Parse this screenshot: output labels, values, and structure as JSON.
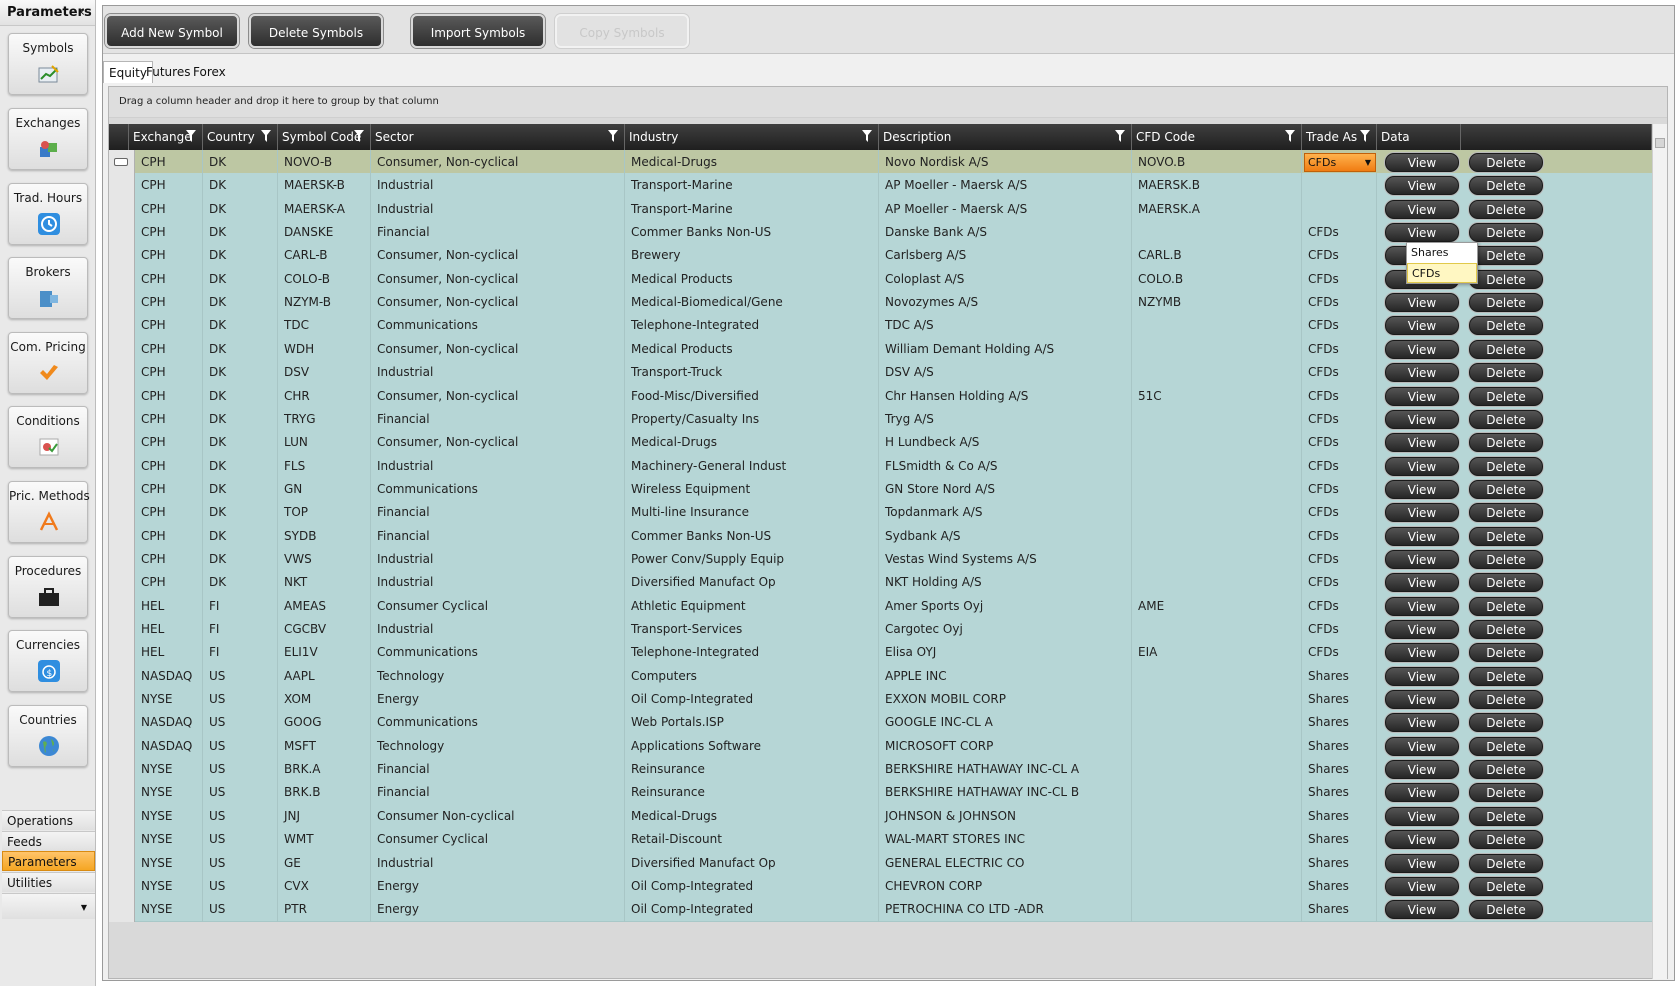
{
  "left_panel": {
    "title": "Parameters",
    "nav": [
      {
        "label": "Symbols",
        "icon": "symbols-chart-icon"
      },
      {
        "label": "Exchanges",
        "icon": "exchanges-icon"
      },
      {
        "label": "Trad. Hours",
        "icon": "clock-icon"
      },
      {
        "label": "Brokers",
        "icon": "broker-icon"
      },
      {
        "label": "Com. Pricing",
        "icon": "commission-icon"
      },
      {
        "label": "Conditions",
        "icon": "conditions-icon"
      },
      {
        "label": "Pric. Methods",
        "icon": "pricing-methods-icon"
      },
      {
        "label": "Procedures",
        "icon": "briefcase-icon"
      },
      {
        "label": "Currencies",
        "icon": "currency-icon"
      },
      {
        "label": "Countries",
        "icon": "globe-icon"
      }
    ],
    "sections": [
      "Operations",
      "Feeds",
      "Parameters",
      "Utilities"
    ],
    "active_section": "Parameters"
  },
  "toolbar": {
    "add_label": "Add New Symbol",
    "delete_label": "Delete Symbols",
    "import_label": "Import Symbols",
    "copy_label": "Copy Symbols"
  },
  "tabs": [
    "Equity",
    "Futures",
    "Forex"
  ],
  "grid": {
    "group_hint": "Drag a column header and drop it here to group by that column",
    "columns": [
      "Exchange",
      "Country",
      "Symbol Code",
      "Sector",
      "Industry",
      "Description",
      "CFD Code",
      "Trade As",
      "Data",
      ""
    ],
    "view_label": "View",
    "delete_label": "Delete",
    "trade_dropdown": {
      "selected": "CFDs",
      "options": [
        "Shares",
        "CFDs"
      ]
    },
    "rows": [
      {
        "exchange": "CPH",
        "country": "DK",
        "symbol": "NOVO-B",
        "sector": "Consumer, Non-cyclical",
        "industry": "Medical-Drugs",
        "description": "Novo Nordisk A/S",
        "cfd": "NOVO.B",
        "trade": "CFDs"
      },
      {
        "exchange": "CPH",
        "country": "DK",
        "symbol": "MAERSK-B",
        "sector": "Industrial",
        "industry": "Transport-Marine",
        "description": "AP Moeller - Maersk A/S",
        "cfd": "MAERSK.B",
        "trade": ""
      },
      {
        "exchange": "CPH",
        "country": "DK",
        "symbol": "MAERSK-A",
        "sector": "Industrial",
        "industry": "Transport-Marine",
        "description": "AP Moeller - Maersk A/S",
        "cfd": "MAERSK.A",
        "trade": ""
      },
      {
        "exchange": "CPH",
        "country": "DK",
        "symbol": "DANSKE",
        "sector": "Financial",
        "industry": "Commer Banks Non-US",
        "description": "Danske Bank A/S",
        "cfd": "",
        "trade": "CFDs"
      },
      {
        "exchange": "CPH",
        "country": "DK",
        "symbol": "CARL-B",
        "sector": "Consumer, Non-cyclical",
        "industry": "Brewery",
        "description": "Carlsberg A/S",
        "cfd": "CARL.B",
        "trade": "CFDs"
      },
      {
        "exchange": "CPH",
        "country": "DK",
        "symbol": "COLO-B",
        "sector": "Consumer, Non-cyclical",
        "industry": "Medical Products",
        "description": "Coloplast A/S",
        "cfd": "COLO.B",
        "trade": "CFDs"
      },
      {
        "exchange": "CPH",
        "country": "DK",
        "symbol": "NZYM-B",
        "sector": "Consumer, Non-cyclical",
        "industry": "Medical-Biomedical/Gene",
        "description": "Novozymes A/S",
        "cfd": "NZYMB",
        "trade": "CFDs"
      },
      {
        "exchange": "CPH",
        "country": "DK",
        "symbol": "TDC",
        "sector": "Communications",
        "industry": "Telephone-Integrated",
        "description": "TDC A/S",
        "cfd": "",
        "trade": "CFDs"
      },
      {
        "exchange": "CPH",
        "country": "DK",
        "symbol": "WDH",
        "sector": "Consumer, Non-cyclical",
        "industry": "Medical Products",
        "description": "William Demant Holding A/S",
        "cfd": "",
        "trade": "CFDs"
      },
      {
        "exchange": "CPH",
        "country": "DK",
        "symbol": "DSV",
        "sector": "Industrial",
        "industry": "Transport-Truck",
        "description": "DSV A/S",
        "cfd": "",
        "trade": "CFDs"
      },
      {
        "exchange": "CPH",
        "country": "DK",
        "symbol": "CHR",
        "sector": "Consumer, Non-cyclical",
        "industry": "Food-Misc/Diversified",
        "description": "Chr Hansen Holding A/S",
        "cfd": "51C",
        "trade": "CFDs"
      },
      {
        "exchange": "CPH",
        "country": "DK",
        "symbol": "TRYG",
        "sector": "Financial",
        "industry": "Property/Casualty Ins",
        "description": "Tryg A/S",
        "cfd": "",
        "trade": "CFDs"
      },
      {
        "exchange": "CPH",
        "country": "DK",
        "symbol": "LUN",
        "sector": "Consumer, Non-cyclical",
        "industry": "Medical-Drugs",
        "description": "H Lundbeck A/S",
        "cfd": "",
        "trade": "CFDs"
      },
      {
        "exchange": "CPH",
        "country": "DK",
        "symbol": "FLS",
        "sector": "Industrial",
        "industry": "Machinery-General Indust",
        "description": "FLSmidth & Co A/S",
        "cfd": "",
        "trade": "CFDs"
      },
      {
        "exchange": "CPH",
        "country": "DK",
        "symbol": "GN",
        "sector": "Communications",
        "industry": "Wireless Equipment",
        "description": "GN Store Nord A/S",
        "cfd": "",
        "trade": "CFDs"
      },
      {
        "exchange": "CPH",
        "country": "DK",
        "symbol": "TOP",
        "sector": "Financial",
        "industry": "Multi-line Insurance",
        "description": "Topdanmark A/S",
        "cfd": "",
        "trade": "CFDs"
      },
      {
        "exchange": "CPH",
        "country": "DK",
        "symbol": "SYDB",
        "sector": "Financial",
        "industry": "Commer Banks Non-US",
        "description": "Sydbank A/S",
        "cfd": "",
        "trade": "CFDs"
      },
      {
        "exchange": "CPH",
        "country": "DK",
        "symbol": "VWS",
        "sector": "Industrial",
        "industry": "Power Conv/Supply Equip",
        "description": "Vestas Wind Systems A/S",
        "cfd": "",
        "trade": "CFDs"
      },
      {
        "exchange": "CPH",
        "country": "DK",
        "symbol": "NKT",
        "sector": "Industrial",
        "industry": "Diversified Manufact Op",
        "description": "NKT Holding A/S",
        "cfd": "",
        "trade": "CFDs"
      },
      {
        "exchange": "HEL",
        "country": "FI",
        "symbol": "AMEAS",
        "sector": "Consumer Cyclical",
        "industry": "Athletic Equipment",
        "description": "Amer Sports Oyj",
        "cfd": "AME",
        "trade": "CFDs"
      },
      {
        "exchange": "HEL",
        "country": "FI",
        "symbol": "CGCBV",
        "sector": "Industrial",
        "industry": "Transport-Services",
        "description": "Cargotec Oyj",
        "cfd": "",
        "trade": "CFDs"
      },
      {
        "exchange": "HEL",
        "country": "FI",
        "symbol": "ELI1V",
        "sector": "Communications",
        "industry": "Telephone-Integrated",
        "description": "Elisa OYJ",
        "cfd": "EIA",
        "trade": "CFDs"
      },
      {
        "exchange": "NASDAQ",
        "country": "US",
        "symbol": "AAPL",
        "sector": "Technology",
        "industry": "Computers",
        "description": "APPLE INC",
        "cfd": "",
        "trade": "Shares"
      },
      {
        "exchange": "NYSE",
        "country": "US",
        "symbol": "XOM",
        "sector": "Energy",
        "industry": "Oil Comp-Integrated",
        "description": "EXXON MOBIL CORP",
        "cfd": "",
        "trade": "Shares"
      },
      {
        "exchange": "NASDAQ",
        "country": "US",
        "symbol": "GOOG",
        "sector": "Communications",
        "industry": "Web Portals.ISP",
        "description": "GOOGLE INC-CL A",
        "cfd": "",
        "trade": "Shares"
      },
      {
        "exchange": "NASDAQ",
        "country": "US",
        "symbol": "MSFT",
        "sector": "Technology",
        "industry": "Applications Software",
        "description": "MICROSOFT CORP",
        "cfd": "",
        "trade": "Shares"
      },
      {
        "exchange": "NYSE",
        "country": "US",
        "symbol": "BRK.A",
        "sector": "Financial",
        "industry": "Reinsurance",
        "description": "BERKSHIRE HATHAWAY INC-CL A",
        "cfd": "",
        "trade": "Shares"
      },
      {
        "exchange": "NYSE",
        "country": "US",
        "symbol": "BRK.B",
        "sector": "Financial",
        "industry": "Reinsurance",
        "description": "BERKSHIRE HATHAWAY INC-CL B",
        "cfd": "",
        "trade": "Shares"
      },
      {
        "exchange": "NYSE",
        "country": "US",
        "symbol": "JNJ",
        "sector": "Consumer Non-cyclical",
        "industry": "Medical-Drugs",
        "description": "JOHNSON & JOHNSON",
        "cfd": "",
        "trade": "Shares"
      },
      {
        "exchange": "NYSE",
        "country": "US",
        "symbol": "WMT",
        "sector": "Consumer Cyclical",
        "industry": "Retail-Discount",
        "description": "WAL-MART STORES INC",
        "cfd": "",
        "trade": "Shares"
      },
      {
        "exchange": "NYSE",
        "country": "US",
        "symbol": "GE",
        "sector": "Industrial",
        "industry": "Diversified Manufact Op",
        "description": "GENERAL ELECTRIC CO",
        "cfd": "",
        "trade": "Shares"
      },
      {
        "exchange": "NYSE",
        "country": "US",
        "symbol": "CVX",
        "sector": "Energy",
        "industry": "Oil Comp-Integrated",
        "description": "CHEVRON CORP",
        "cfd": "",
        "trade": "Shares"
      },
      {
        "exchange": "NYSE",
        "country": "US",
        "symbol": "PTR",
        "sector": "Energy",
        "industry": "Oil Comp-Integrated",
        "description": "PETROCHINA CO LTD -ADR",
        "cfd": "",
        "trade": "Shares"
      }
    ]
  },
  "colors": {
    "row_bg": "#b6d6d6",
    "selected_row": "#bdc7a3",
    "accent_orange": "#f5a623",
    "header_dark": "#2b2b2b"
  }
}
